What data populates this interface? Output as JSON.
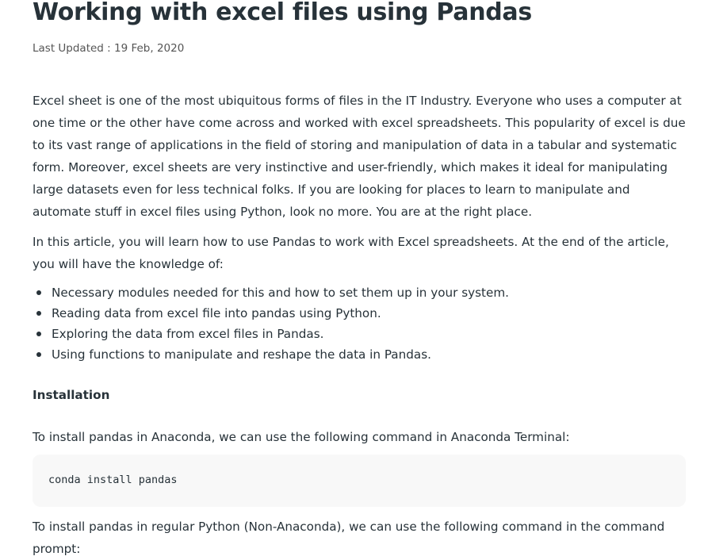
{
  "article": {
    "title": "Working with excel files using Pandas",
    "last_updated": "Last Updated : 19 Feb, 2020",
    "intro": "Excel sheet is one of the most ubiquitous forms of files in the IT Industry. Everyone who uses a computer at one time or the other have come across and worked with excel spreadsheets. This popularity of excel is due to its vast range of applications in the field of storing and manipulation of data in a tabular and systematic form. Moreover, excel sheets are very instinctive and user-friendly, which makes it ideal for manipulating large datasets even for less technical folks. If you are looking for places to learn to manipulate and automate stuff in excel files using Python, look no more. You are at the right place.",
    "knowledge_intro": "In this article, you will learn how to use Pandas to work with Excel spreadsheets. At the end of the article, you will have the knowledge of:",
    "knowledge_items": [
      "Necessary modules needed for this and how to set them up in your system.",
      "Reading data from excel file into pandas using Python.",
      "Exploring the data from excel files in Pandas.",
      "Using functions to manipulate and reshape the data in Pandas."
    ],
    "installation_heading": "Installation",
    "anaconda_instruction": "To install pandas in Anaconda, we can use the following command in Anaconda Terminal:",
    "anaconda_command": "conda install pandas",
    "python_instruction": "To install pandas in regular Python (Non-Anaconda), we can use the following command in the command prompt:"
  },
  "colors": {
    "text": "#273239",
    "code_background": "#f8f8f8"
  }
}
